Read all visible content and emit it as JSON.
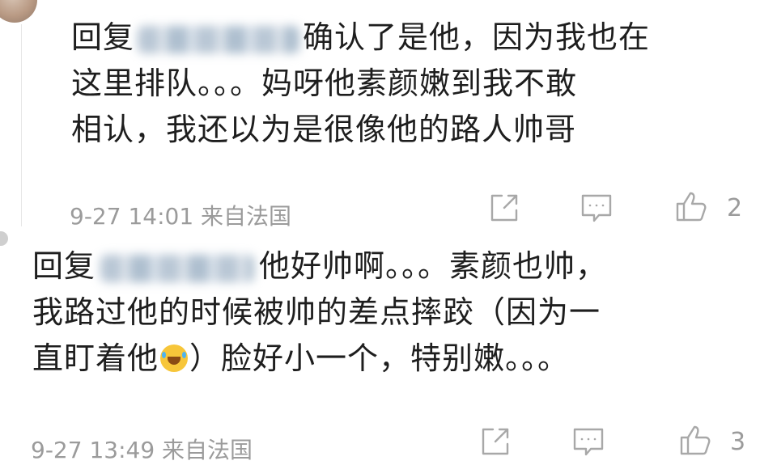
{
  "comments": [
    {
      "reply_prefix": "回复",
      "line1_rest": "确认了是他，因为我也在",
      "line2": "这里排队。。。妈呀他素颜嫩到我不敢",
      "line3": "相认，我还以为是很像他的路人帅哥",
      "timestamp": "9-27 14:01",
      "source": "来自法国",
      "likes": "2"
    },
    {
      "reply_prefix": "回复",
      "line1_rest": "他好帅啊。。。素颜也帅，",
      "line2": "我路过他的时候被帅的差点摔跤（因为一",
      "line3_before_emoji": "直盯着他",
      "line3_after_emoji": "）脸好小一个，特别嫩。。。",
      "timestamp": "9-27 13:49",
      "source": "来自法国",
      "likes": "3"
    }
  ],
  "icons": {
    "share": "share-icon",
    "comment": "comment-icon",
    "like": "like-icon",
    "emoji": "laughing-crying-emoji"
  },
  "colors": {
    "text": "#1e1e1e",
    "meta": "#9b9b9b"
  }
}
